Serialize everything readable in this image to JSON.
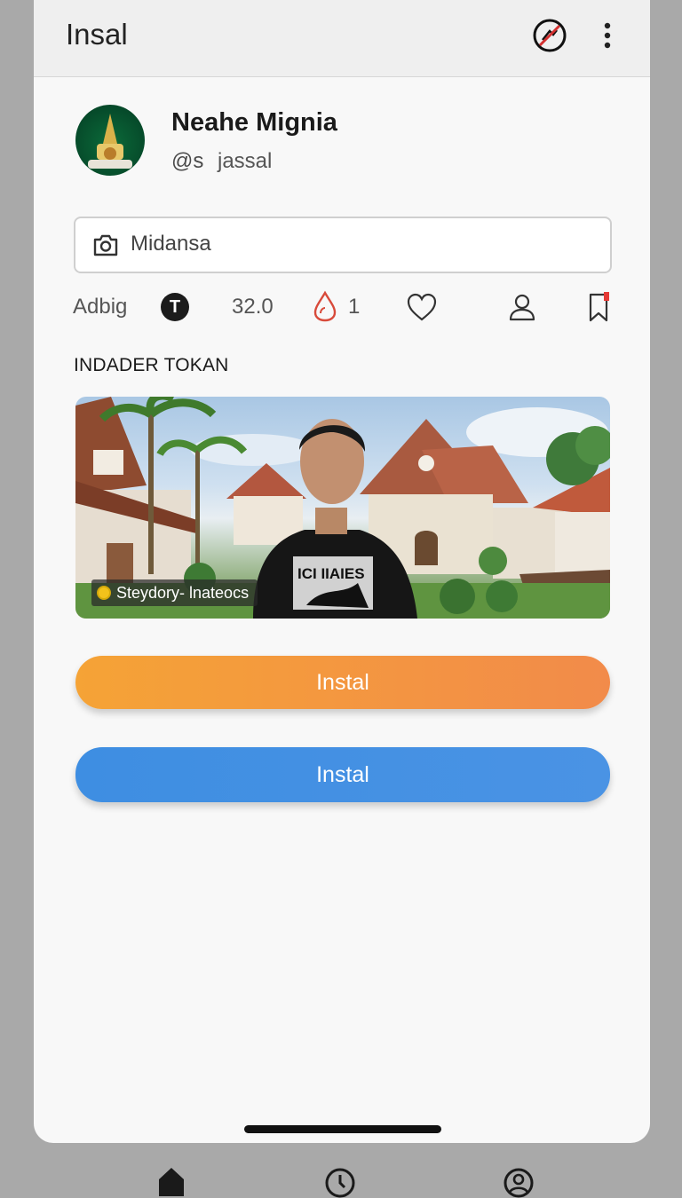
{
  "header": {
    "title": "Insal"
  },
  "profile": {
    "name": "Neahe Mignia",
    "handle_icon_text": "@s",
    "handle": "jassal"
  },
  "search": {
    "label": "Midansa"
  },
  "stats": {
    "label": "Adbig",
    "badge_letter": "T",
    "count": "32.0",
    "likes": "1"
  },
  "section": {
    "title": "INDADER TOKAN"
  },
  "photo": {
    "caption": "Steydory- lnateocs",
    "shirt_text": "ICI IIAIES"
  },
  "buttons": {
    "primary_label": "Instal",
    "secondary_label": "Instal"
  },
  "colors": {
    "orange": "#f5a336",
    "blue": "#3e8ee2",
    "bookmark_accent": "#e53935"
  },
  "icons": [
    "no-camera-icon",
    "more-vertical-icon",
    "camera-icon",
    "t-badge-icon",
    "drop-icon",
    "heart-icon",
    "person-icon",
    "bookmark-icon",
    "home-icon",
    "clock-icon",
    "profile-icon"
  ]
}
